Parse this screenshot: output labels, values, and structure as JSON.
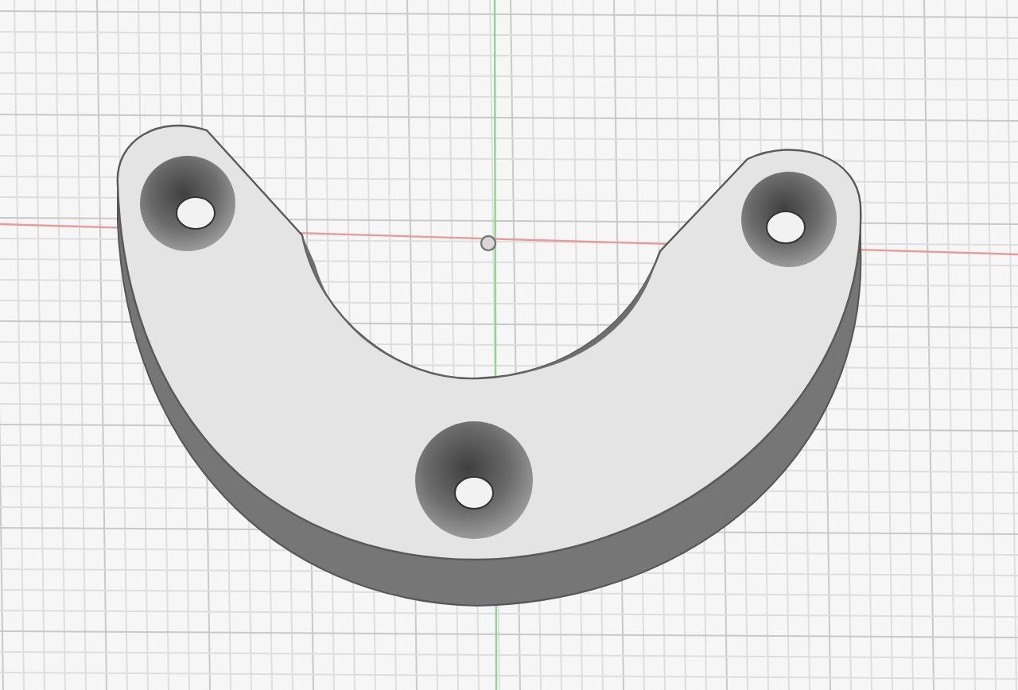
{
  "viewport": {
    "grid_visible": true,
    "origin_visible": true
  }
}
